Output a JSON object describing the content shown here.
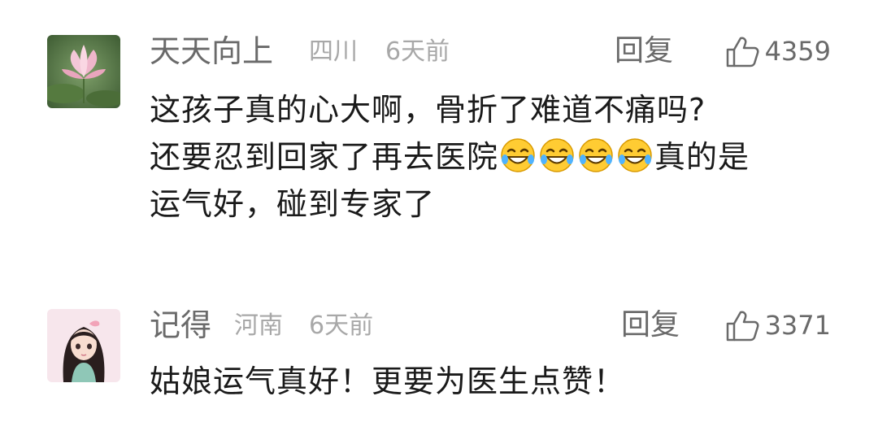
{
  "comments": [
    {
      "username": "天天向上",
      "location": "四川",
      "time": "6天前",
      "reply_label": "回复",
      "like_count": "4359",
      "avatar": "lotus-flower-avatar",
      "text_line1": "这孩子真的心大啊，骨折了难道不痛吗?",
      "text_line2a": "还要忍到回家了再去医院",
      "emojis": [
        "laughing-crying-emoji",
        "laughing-crying-emoji",
        "laughing-crying-emoji",
        "laughing-crying-emoji"
      ],
      "text_line2b": "真的是",
      "text_line3": "运气好，碰到专家了"
    },
    {
      "username": "记得",
      "location": "河南",
      "time": "6天前",
      "reply_label": "回复",
      "like_count": "3371",
      "avatar": "anime-girl-avatar",
      "text_line1": "姑娘运气真好！更要为医生点赞！"
    }
  ],
  "colors": {
    "username": "#6a6a6a",
    "meta": "#a8a8a8",
    "body_text": "#1a1a1a",
    "background": "#ffffff"
  }
}
